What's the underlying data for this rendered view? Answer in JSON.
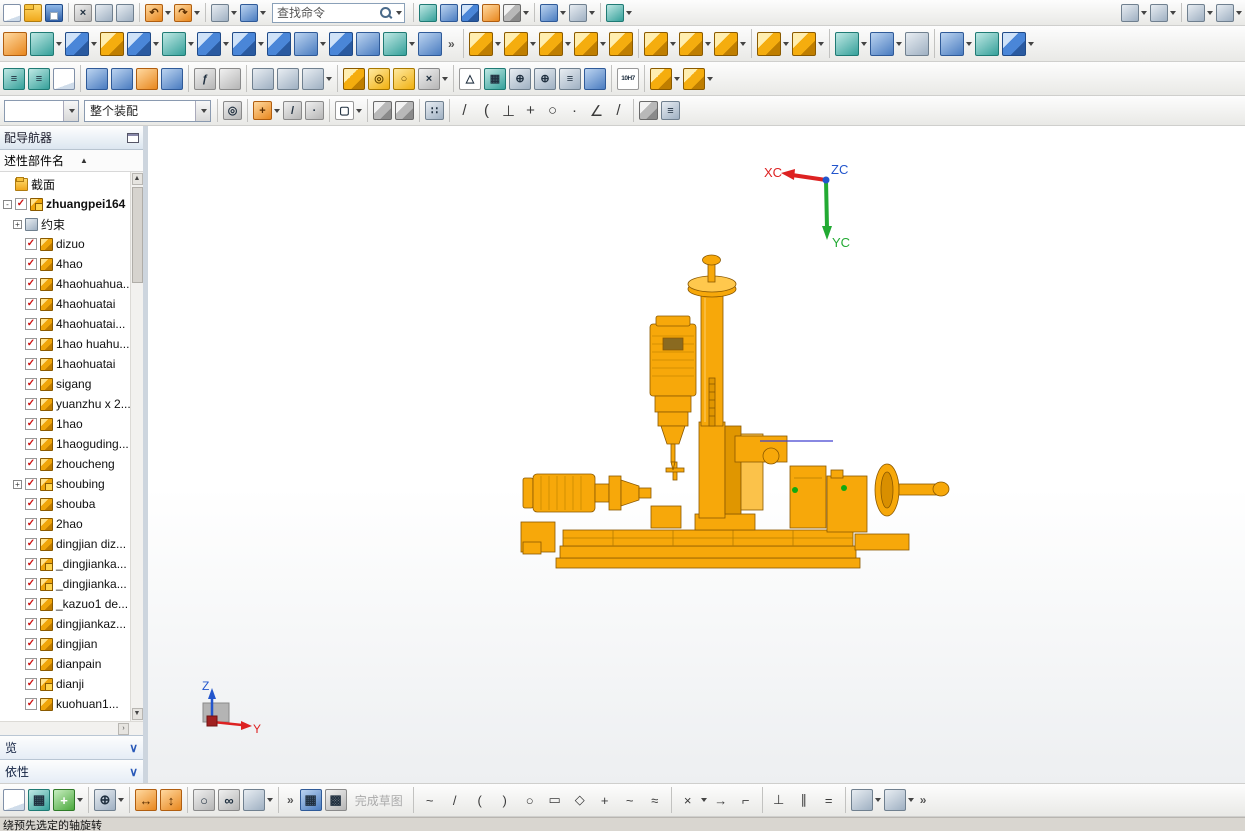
{
  "app": {
    "status_text": "绕预先选定的轴旋转"
  },
  "panels": {
    "preview": "览",
    "dependencies": "依性",
    "chevron": "∨"
  },
  "navigator": {
    "title": "配导航器",
    "column_header": "述性部件名",
    "sort_icon": "▲",
    "check_glyph": "✓",
    "scroll_up_icon": "▲",
    "scroll_down_icon": "▼",
    "scroll_right_icon": "›",
    "items": [
      {
        "label": "截面",
        "icon": "folder"
      },
      {
        "label": "zhuangpei164",
        "icon": "assembly",
        "checked": true,
        "expand": "-",
        "bold": true
      },
      {
        "label": "约束",
        "icon": "constraints",
        "expand": "+",
        "child": true
      },
      {
        "label": "dizuo",
        "icon": "part",
        "checked": true,
        "child": true
      },
      {
        "label": "4hao",
        "icon": "part",
        "checked": true,
        "child": true
      },
      {
        "label": "4haohuahua...",
        "icon": "part",
        "checked": true,
        "child": true
      },
      {
        "label": "4haohuatai",
        "icon": "part",
        "checked": true,
        "child": true
      },
      {
        "label": "4haohuatai...",
        "icon": "part",
        "checked": true,
        "child": true
      },
      {
        "label": "1hao huahu...",
        "icon": "part",
        "checked": true,
        "child": true
      },
      {
        "label": "1haohuatai",
        "icon": "part",
        "checked": true,
        "child": true
      },
      {
        "label": "sigang",
        "icon": "part",
        "checked": true,
        "child": true
      },
      {
        "label": "yuanzhu x 2...",
        "icon": "part",
        "checked": true,
        "child": true
      },
      {
        "label": "1hao",
        "icon": "part",
        "checked": true,
        "child": true
      },
      {
        "label": "1haoguding...",
        "icon": "part",
        "checked": true,
        "child": true
      },
      {
        "label": "zhoucheng",
        "icon": "part",
        "checked": true,
        "child": true
      },
      {
        "label": "shoubing",
        "icon": "assembly",
        "checked": true,
        "expand": "+",
        "child": true
      },
      {
        "label": "shouba",
        "icon": "part",
        "checked": true,
        "child": true
      },
      {
        "label": "2hao",
        "icon": "part",
        "checked": true,
        "child": true
      },
      {
        "label": "dingjian diz...",
        "icon": "part",
        "checked": true,
        "child": true
      },
      {
        "label": "_dingjianka...",
        "icon": "assembly",
        "checked": true,
        "child": true
      },
      {
        "label": "_dingjianka...",
        "icon": "assembly",
        "checked": true,
        "child": true
      },
      {
        "label": "_kazuo1 de...",
        "icon": "part",
        "checked": true,
        "child": true
      },
      {
        "label": "dingjiankaz...",
        "icon": "part",
        "checked": true,
        "child": true
      },
      {
        "label": "dingjian",
        "icon": "part",
        "checked": true,
        "child": true
      },
      {
        "label": "dianpain",
        "icon": "part",
        "checked": true,
        "child": true
      },
      {
        "label": "dianji",
        "icon": "assembly",
        "checked": true,
        "child": true
      },
      {
        "label": "kuohuan1...",
        "icon": "part",
        "checked": true,
        "child": true
      }
    ]
  },
  "viewport": {
    "triad": {
      "xc": "XC",
      "yc": "YC",
      "zc": "ZC"
    },
    "wcs": {
      "z": "Z",
      "y": "Y"
    },
    "colors": {
      "model": "#F7A80A",
      "model_edge": "#8a5800",
      "x_axis": "#dd2222",
      "y_axis": "#22aa33",
      "z_axis": "#2255cc",
      "construction_line": "#4040d0"
    }
  },
  "toolbars": {
    "row1": [
      {
        "name": "new-file",
        "c": "page"
      },
      {
        "name": "open-file",
        "c": "folder"
      },
      {
        "name": "save",
        "c": "disk"
      },
      {
        "t": "sep"
      },
      {
        "name": "cut",
        "c": "tile-gray",
        "g": "×"
      },
      {
        "name": "copy",
        "c": "tile-steel"
      },
      {
        "name": "paste",
        "c": "tile-steel"
      },
      {
        "t": "sep"
      },
      {
        "name": "undo",
        "c": "tile-orange",
        "g": "↶",
        "dd": true
      },
      {
        "name": "redo",
        "c": "tile-orange",
        "g": "↷",
        "dd": true
      },
      {
        "t": "sep"
      },
      {
        "name": "view-orientation",
        "c": "tile-steel",
        "dd": true
      },
      {
        "name": "repeat-command",
        "c": "tile-blue",
        "dd": true
      },
      {
        "t": "search",
        "name": "command-finder",
        "placeholder": "查找命令"
      },
      {
        "t": "sep"
      },
      {
        "name": "move-object",
        "c": "tile-teal"
      },
      {
        "name": "show-hide",
        "c": "tile-blue"
      },
      {
        "name": "display-object",
        "c": "bcube"
      },
      {
        "name": "copy-display",
        "c": "tile-orange"
      },
      {
        "name": "render-style",
        "c": "gcube",
        "dd": true
      },
      {
        "t": "sep"
      },
      {
        "name": "new-window",
        "c": "tile-blue",
        "dd": true
      },
      {
        "name": "window-cascade",
        "c": "tile-steel",
        "dd": true
      },
      {
        "t": "sep"
      },
      {
        "name": "user-defined-view",
        "c": "tile-teal",
        "dd": true
      },
      {
        "t": "space"
      },
      {
        "name": "quick-dimension",
        "c": "tile-steel",
        "dd": true
      },
      {
        "name": "annotation-note",
        "c": "tile-steel",
        "dd": true
      },
      {
        "t": "sep"
      },
      {
        "name": "datum-dimension",
        "c": "tile-steel",
        "dd": true
      },
      {
        "name": "linear-dimension",
        "c": "tile-steel",
        "dd": true
      }
    ],
    "row2": [
      {
        "name": "direct-sketch",
        "c": "tile-orange"
      },
      {
        "name": "datum-plane",
        "c": "tile-teal",
        "dd": true
      },
      {
        "name": "extrude",
        "c": "bcube",
        "dd": true
      },
      {
        "name": "revolve",
        "c": "ycube"
      },
      {
        "name": "hole",
        "c": "bcube",
        "dd": true
      },
      {
        "name": "pattern-feature",
        "c": "tile-teal",
        "dd": true
      },
      {
        "name": "unite",
        "c": "bcube",
        "dd": true
      },
      {
        "name": "edge-blend",
        "c": "bcube",
        "dd": true
      },
      {
        "name": "chamfer",
        "c": "bcube"
      },
      {
        "name": "trim-body",
        "c": "tile-blue",
        "dd": true
      },
      {
        "name": "shell",
        "c": "bcube"
      },
      {
        "name": "draft-feature",
        "c": "tile-blue"
      },
      {
        "name": "swept",
        "c": "tile-teal",
        "dd": true
      },
      {
        "name": "tube",
        "c": "tile-blue"
      },
      {
        "t": "overflow",
        "name": "modeling-overflow"
      },
      {
        "t": "sep"
      },
      {
        "name": "add-component",
        "c": "ycube",
        "dd": true
      },
      {
        "name": "assembly-constraints",
        "c": "ycube",
        "dd": true
      },
      {
        "name": "move-component",
        "c": "ycube",
        "dd": true
      },
      {
        "name": "pattern-component",
        "c": "ycube",
        "dd": true
      },
      {
        "name": "mirror-assembly",
        "c": "ycube"
      },
      {
        "t": "sep"
      },
      {
        "name": "exploded-views",
        "c": "ycube",
        "dd": true
      },
      {
        "name": "assembly-sequence",
        "c": "ycube",
        "dd": true
      },
      {
        "name": "arrangements",
        "c": "ycube",
        "dd": true
      },
      {
        "t": "sep"
      },
      {
        "name": "wave-geometry-linker",
        "c": "ycube",
        "dd": true
      },
      {
        "name": "interpart-links",
        "c": "ycube",
        "dd": true
      },
      {
        "t": "sep"
      },
      {
        "name": "measure-distance",
        "c": "tile-teal",
        "dd": true
      },
      {
        "name": "section-analysis",
        "c": "tile-blue",
        "dd": true
      },
      {
        "name": "high-quality-image",
        "c": "tile-steel"
      },
      {
        "t": "sep"
      },
      {
        "name": "reflection-analysis",
        "c": "tile-blue",
        "dd": true
      },
      {
        "name": "face-analysis",
        "c": "tile-teal"
      },
      {
        "name": "draft-analysis",
        "c": "bcube",
        "dd": true
      }
    ],
    "row3": [
      {
        "name": "assembly-navigator-toggle",
        "c": "tile-teal",
        "g": "≡"
      },
      {
        "name": "constraint-navigator",
        "c": "tile-teal",
        "g": "≡"
      },
      {
        "name": "part-navigator",
        "c": "page"
      },
      {
        "t": "sep"
      },
      {
        "name": "reuse-library",
        "c": "tile-blue"
      },
      {
        "name": "web-browser",
        "c": "tile-blue"
      },
      {
        "name": "history-palette",
        "c": "tile-orange"
      },
      {
        "name": "process-studio",
        "c": "tile-blue"
      },
      {
        "t": "sep"
      },
      {
        "name": "expressions",
        "c": "tile-gray",
        "g": "ƒ"
      },
      {
        "name": "visual-rules",
        "c": "tile-gray"
      },
      {
        "t": "sep"
      },
      {
        "name": "journal-play",
        "c": "tile-steel"
      },
      {
        "name": "journal-record",
        "c": "tile-steel"
      },
      {
        "name": "macro-menu",
        "c": "tile-steel",
        "dd": true
      },
      {
        "t": "sep"
      },
      {
        "name": "cylinder-tool",
        "c": "ycube"
      },
      {
        "name": "spring-tool",
        "c": "tile-yellow",
        "g": "◎"
      },
      {
        "name": "washer-tool",
        "c": "tile-yellow",
        "g": "○"
      },
      {
        "name": "suppress-feature",
        "c": "tile-gray",
        "g": "×",
        "dd": true
      },
      {
        "t": "sep"
      },
      {
        "name": "draft-triangle",
        "c": "tile-white",
        "g": "△"
      },
      {
        "name": "table-grid",
        "c": "tile-teal",
        "g": "▦"
      },
      {
        "name": "pattern-target",
        "c": "tile-steel",
        "g": "⊕"
      },
      {
        "name": "pattern-target-2",
        "c": "tile-steel",
        "g": "⊕"
      },
      {
        "name": "note-editor",
        "c": "tile-steel",
        "g": "≡"
      },
      {
        "name": "surface-finish",
        "c": "tile-blue"
      },
      {
        "t": "sep"
      },
      {
        "name": "tolerance-10H7",
        "c": "tile-white",
        "g": "10H7"
      },
      {
        "t": "sep"
      },
      {
        "name": "boss-feature",
        "c": "ycube",
        "dd": true
      },
      {
        "name": "pocket-feature",
        "c": "ycube",
        "dd": true
      }
    ],
    "row4": [
      {
        "t": "combo",
        "name": "view-combo",
        "value": ""
      },
      {
        "t": "combo",
        "name": "selection-scope-combo",
        "value": "整个装配",
        "wide": true
      },
      {
        "t": "sep"
      },
      {
        "name": "snapshot",
        "c": "tile-gray",
        "g": "◎"
      },
      {
        "t": "sep"
      },
      {
        "name": "snap-point",
        "c": "tile-orange",
        "g": "+",
        "dd": true
      },
      {
        "name": "snap-endpoint",
        "c": "tile-gray",
        "g": "/"
      },
      {
        "name": "snap-midpoint",
        "c": "tile-gray",
        "g": "·"
      },
      {
        "t": "sep"
      },
      {
        "name": "selection-rectangle",
        "c": "tile-white",
        "g": "▢",
        "dd": true
      },
      {
        "t": "sep"
      },
      {
        "name": "extrude-mini",
        "c": "gcube"
      },
      {
        "name": "revolve-mini",
        "c": "gcube"
      },
      {
        "t": "sep"
      },
      {
        "name": "point-set",
        "c": "tile-steel",
        "g": "∷"
      },
      {
        "t": "sep"
      },
      {
        "name": "line-tool",
        "c": "glyph",
        "g": "/"
      },
      {
        "name": "arc-tool",
        "c": "glyph",
        "g": "("
      },
      {
        "name": "perpendicular-tool",
        "c": "glyph",
        "g": "⊥"
      },
      {
        "name": "axis-tool",
        "c": "glyph",
        "g": "+"
      },
      {
        "name": "circle-tool",
        "c": "glyph",
        "g": "○"
      },
      {
        "name": "point-tool",
        "c": "glyph",
        "g": "·"
      },
      {
        "name": "angle-tool",
        "c": "glyph",
        "g": "∠"
      },
      {
        "name": "slash-tool",
        "c": "glyph",
        "g": "/"
      },
      {
        "t": "sep"
      },
      {
        "name": "mini-cube",
        "c": "gcube"
      },
      {
        "name": "list-view",
        "c": "tile-steel",
        "g": "≡"
      }
    ],
    "bottom": [
      {
        "name": "drawing-new",
        "c": "page"
      },
      {
        "name": "table-bottom",
        "c": "tile-teal",
        "g": "▦"
      },
      {
        "name": "add-new",
        "c": "tile-green",
        "g": "+",
        "dd": true
      },
      {
        "t": "sep"
      },
      {
        "name": "reattach",
        "c": "tile-steel",
        "g": "⊕",
        "dd": true
      },
      {
        "t": "sep"
      },
      {
        "name": "orient-sketch",
        "c": "tile-orange",
        "g": "↔"
      },
      {
        "name": "orient-view",
        "c": "tile-orange",
        "g": "↕"
      },
      {
        "t": "sep"
      },
      {
        "name": "circle-ref",
        "c": "tile-gray",
        "g": "○"
      },
      {
        "name": "link-curves",
        "c": "tile-gray",
        "g": "∞"
      },
      {
        "name": "sketch-dimensions",
        "c": "tile-steel",
        "dd": true
      },
      {
        "t": "sep"
      },
      {
        "t": "overflow",
        "name": "bottom-overflow-1"
      },
      {
        "name": "grid-display",
        "c": "tile-blue",
        "g": "▦"
      },
      {
        "name": "shade-region",
        "c": "tile-gray",
        "g": "▩"
      },
      {
        "t": "label",
        "name": "finish-sketch",
        "text": "完成草图",
        "disabled": true
      },
      {
        "t": "sep"
      },
      {
        "name": "profile-tool",
        "c": "glyph",
        "g": "~"
      },
      {
        "name": "line-sketch",
        "c": "glyph",
        "g": "/"
      },
      {
        "name": "arc-sketch",
        "c": "glyph",
        "g": "("
      },
      {
        "name": "arc-sketch-2",
        "c": "glyph",
        "g": ")"
      },
      {
        "name": "circle-sketch",
        "c": "glyph",
        "g": "○"
      },
      {
        "name": "rectangle-sketch",
        "c": "glyph",
        "g": "▭"
      },
      {
        "name": "polygon-sketch",
        "c": "glyph",
        "g": "◇"
      },
      {
        "name": "point-sketch",
        "c": "glyph",
        "g": "+"
      },
      {
        "name": "spline-sketch",
        "c": "glyph",
        "g": "~"
      },
      {
        "name": "offset-curve",
        "c": "glyph",
        "g": "≈"
      },
      {
        "t": "sep"
      },
      {
        "name": "quick-trim",
        "c": "glyph",
        "g": "×",
        "dd": true
      },
      {
        "name": "quick-extend",
        "c": "glyph",
        "g": "→"
      },
      {
        "name": "fillet-sketch",
        "c": "glyph",
        "g": "⌐"
      },
      {
        "t": "sep"
      },
      {
        "name": "geometric-constraints",
        "c": "glyph",
        "g": "⊥"
      },
      {
        "name": "parallel-constraint",
        "c": "glyph",
        "g": "∥"
      },
      {
        "name": "equal-constraint",
        "c": "glyph",
        "g": "="
      },
      {
        "t": "sep"
      },
      {
        "name": "show-constraints",
        "c": "tile-steel",
        "dd": true
      },
      {
        "name": "auto-dimension",
        "c": "tile-steel",
        "dd": true
      },
      {
        "t": "overflow",
        "name": "bottom-overflow-2"
      }
    ]
  }
}
